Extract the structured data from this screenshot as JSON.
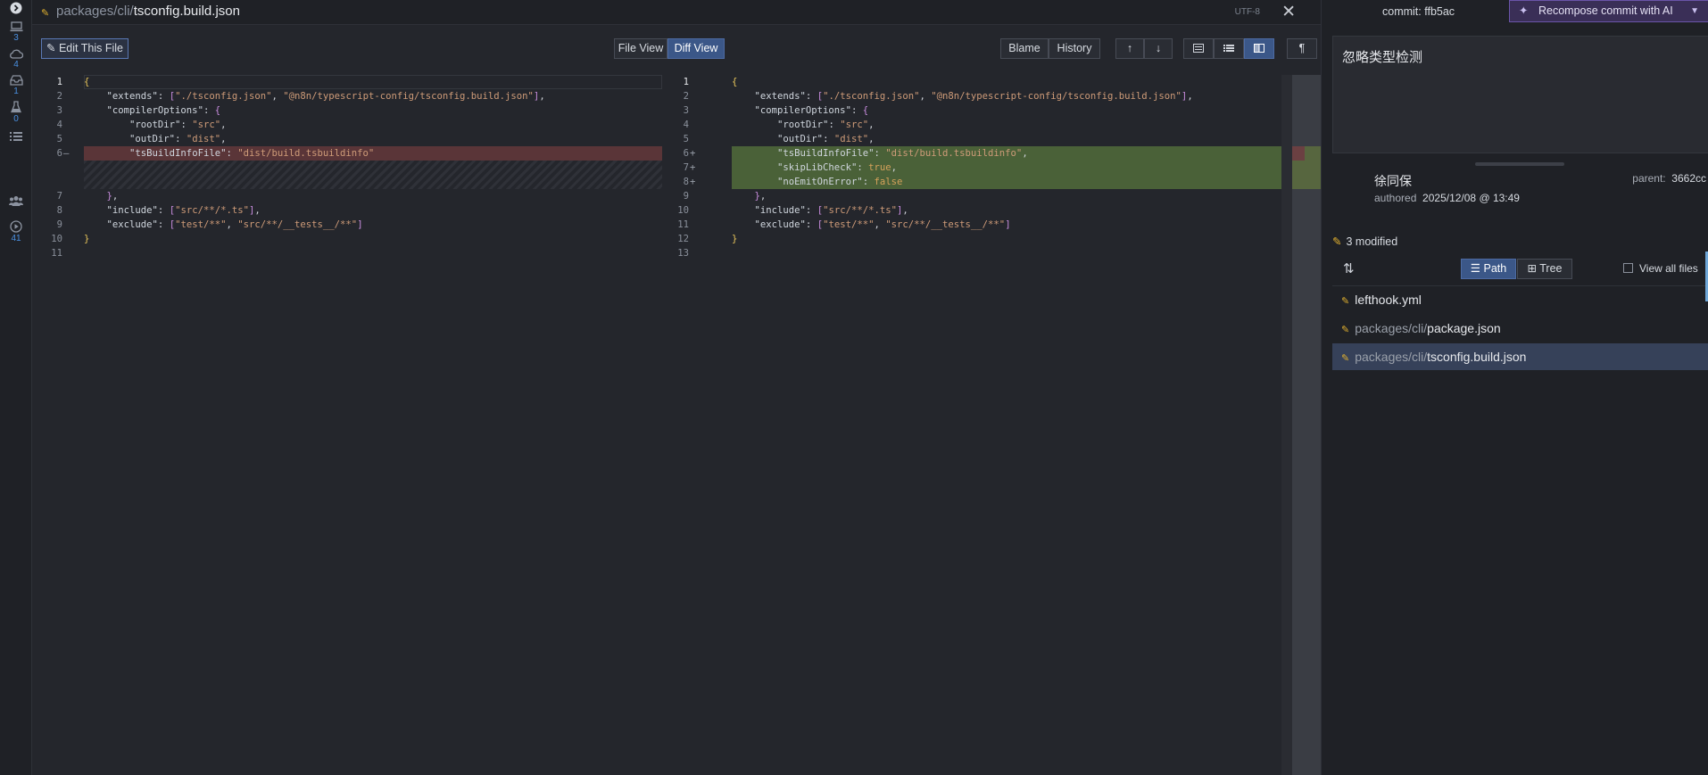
{
  "activity": {
    "items": [
      {
        "icon": "expand-icon",
        "count": ""
      },
      {
        "icon": "laptop-icon",
        "count": "3"
      },
      {
        "icon": "cloud-icon",
        "count": "4"
      },
      {
        "icon": "inbox-icon",
        "count": "1"
      },
      {
        "icon": "flask-icon",
        "count": "0"
      },
      {
        "icon": "list-icon",
        "count": ""
      },
      {
        "icon": "people-icon",
        "count": ""
      },
      {
        "icon": "play-icon",
        "count": "41"
      }
    ]
  },
  "editor": {
    "path_dir": "packages/cli/",
    "path_file": "tsconfig.build.json",
    "encoding": "UTF-8",
    "edit_label": "Edit This File",
    "file_view_label": "File View",
    "diff_view_label": "Diff View",
    "blame_label": "Blame",
    "history_label": "History"
  },
  "left_lines": [
    {
      "n": "1",
      "code": "{"
    },
    {
      "n": "2",
      "code": "    \"extends\": [\"./tsconfig.json\", \"@n8n/typescript-config/tsconfig.build.json\"],"
    },
    {
      "n": "3",
      "code": "    \"compilerOptions\": {"
    },
    {
      "n": "4",
      "code": "        \"rootDir\": \"src\","
    },
    {
      "n": "5",
      "code": "        \"outDir\": \"dist\","
    },
    {
      "n": "6",
      "code": "        \"tsBuildInfoFile\": \"dist/build.tsbuildinfo\""
    },
    {
      "n": "7",
      "code": "    },"
    },
    {
      "n": "8",
      "code": "    \"include\": [\"src/**/*.ts\"],"
    },
    {
      "n": "9",
      "code": "    \"exclude\": [\"test/**\", \"src/**/__tests__/**\"]"
    },
    {
      "n": "10",
      "code": "}"
    },
    {
      "n": "11",
      "code": ""
    }
  ],
  "right_lines": [
    {
      "n": "1",
      "code": "{"
    },
    {
      "n": "2",
      "code": "    \"extends\": [\"./tsconfig.json\", \"@n8n/typescript-config/tsconfig.build.json\"],"
    },
    {
      "n": "3",
      "code": "    \"compilerOptions\": {"
    },
    {
      "n": "4",
      "code": "        \"rootDir\": \"src\","
    },
    {
      "n": "5",
      "code": "        \"outDir\": \"dist\","
    },
    {
      "n": "6",
      "code": "        \"tsBuildInfoFile\": \"dist/build.tsbuildinfo\","
    },
    {
      "n": "7",
      "code": "        \"skipLibCheck\": true,"
    },
    {
      "n": "8",
      "code": "        \"noEmitOnError\": false"
    },
    {
      "n": "9",
      "code": "    },"
    },
    {
      "n": "10",
      "code": "    \"include\": [\"src/**/*.ts\"],"
    },
    {
      "n": "11",
      "code": "    \"exclude\": [\"test/**\", \"src/**/__tests__/**\"]"
    },
    {
      "n": "12",
      "code": "}"
    },
    {
      "n": "13",
      "code": ""
    }
  ],
  "side": {
    "commit_label": "commit:",
    "commit_sha": "ffb5ac",
    "recompose_label": "Recompose commit with AI",
    "message": "忽略类型检测",
    "author": "徐同保",
    "authored_label": "authored",
    "authored_date": "2025/12/08 @ 13:49",
    "parent_label": "parent:",
    "parent_sha": "3662cc",
    "modified_label": "3 modified",
    "path_label": "Path",
    "tree_label": "Tree",
    "view_all_label": "View all files",
    "files": [
      {
        "dir": "",
        "name": "lefthook.yml"
      },
      {
        "dir": "packages/cli/",
        "name": "package.json"
      },
      {
        "dir": "packages/cli/",
        "name": "tsconfig.build.json"
      }
    ]
  }
}
